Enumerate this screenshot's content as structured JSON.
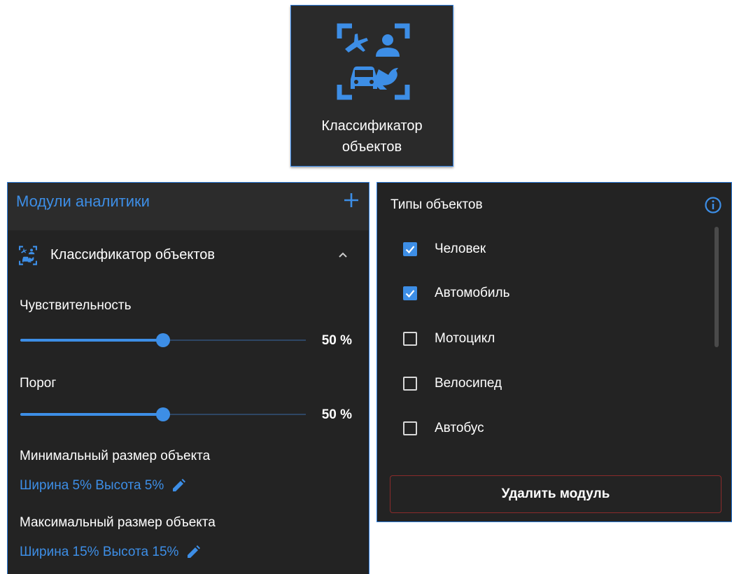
{
  "tile": {
    "label": "Классификатор объектов",
    "icon": "object-classifier-icon"
  },
  "left_panel": {
    "title": "Модули аналитики",
    "add_icon": "plus-icon",
    "module": {
      "name": "Классификатор объектов",
      "icon": "object-classifier-icon",
      "expand_icon": "chevron-up-icon"
    },
    "sensitivity": {
      "label": "Чувствительность",
      "value": 50,
      "value_text": "50 %"
    },
    "threshold": {
      "label": "Порог",
      "value": 50,
      "value_text": "50 %"
    },
    "min_size": {
      "label": "Минимальный размер объекта",
      "value": "Ширина 5% Высота 5%",
      "edit_icon": "pencil-icon"
    },
    "max_size": {
      "label": "Максимальный размер объекта",
      "value": "Ширина 15% Высота 15%",
      "edit_icon": "pencil-icon"
    }
  },
  "right_panel": {
    "title": "Типы объектов",
    "info_icon": "info-icon",
    "object_types": [
      {
        "label": "Человек",
        "checked": true
      },
      {
        "label": "Автомобиль",
        "checked": true
      },
      {
        "label": "Мотоцикл",
        "checked": false
      },
      {
        "label": "Велосипед",
        "checked": false
      },
      {
        "label": "Автобус",
        "checked": false
      }
    ],
    "delete_button": "Удалить модуль"
  },
  "colors": {
    "accent": "#3d8ee6",
    "panel_bg": "#232323",
    "header_bg": "#2c2c2c",
    "danger_border": "#8a2b2b"
  }
}
